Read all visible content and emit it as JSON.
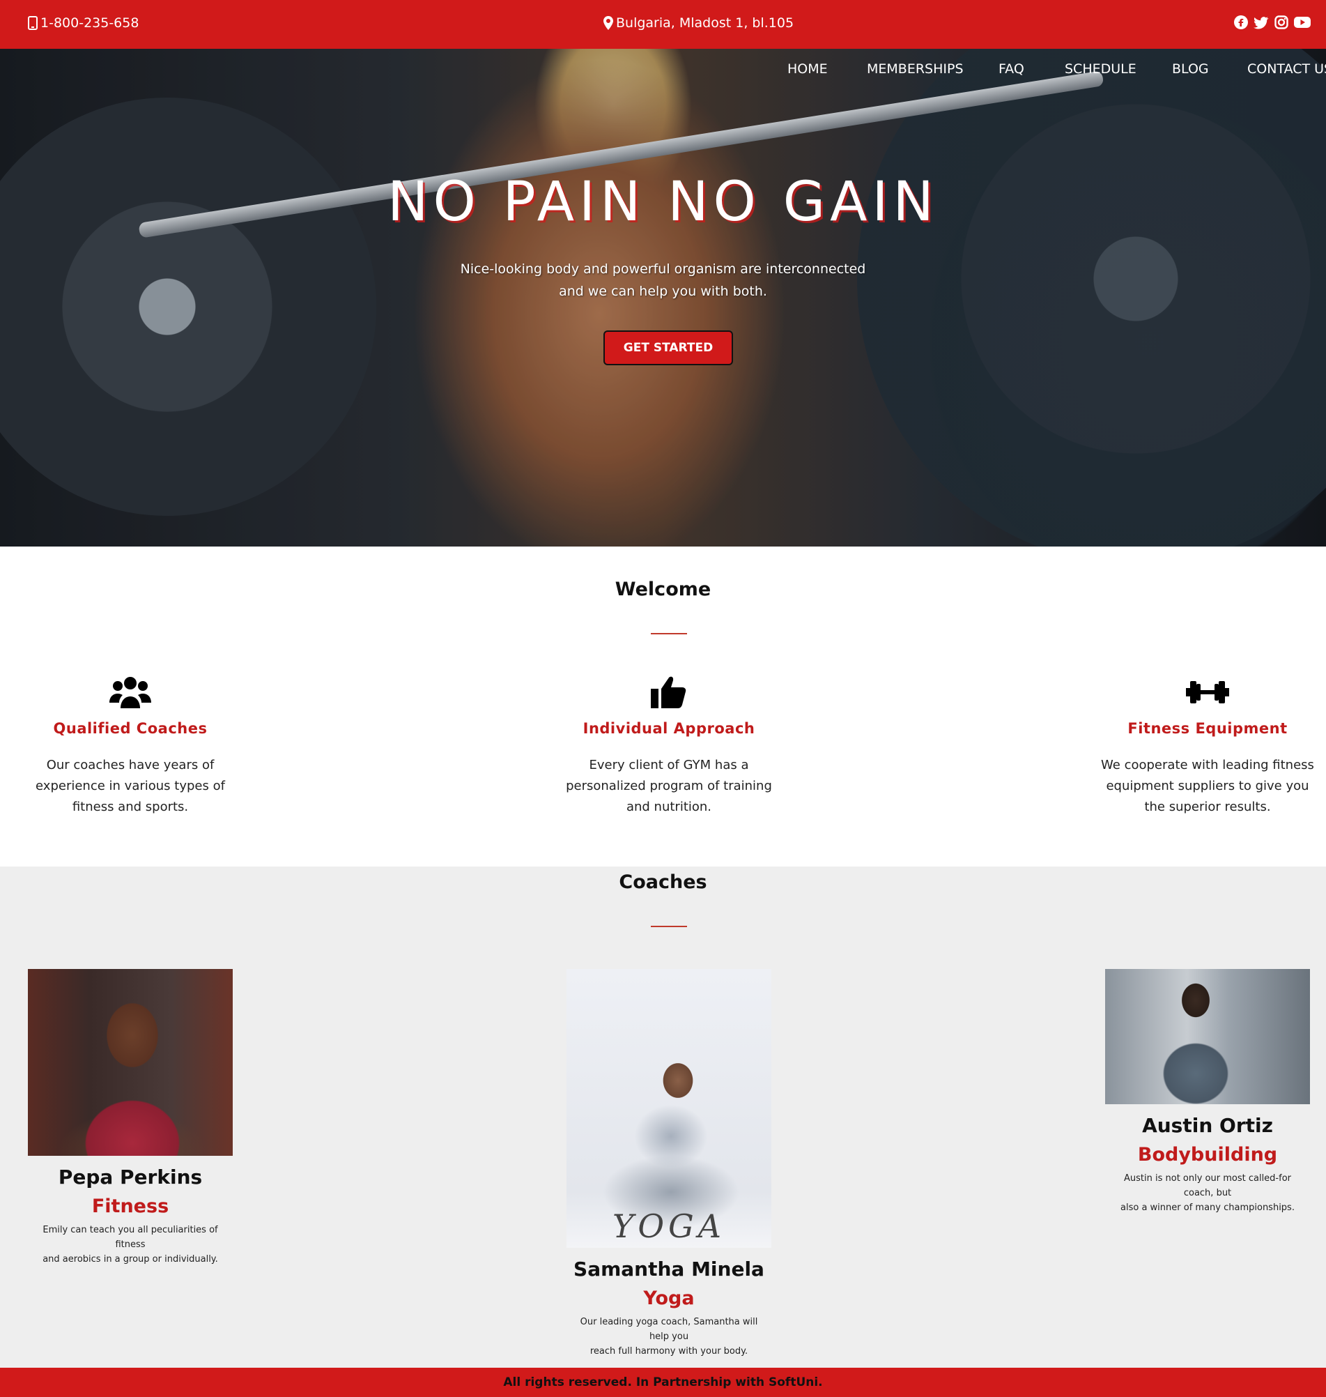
{
  "topbar": {
    "phone": "1-800-235-658",
    "phone_icon": "mobile-phone-icon",
    "address": "Bulgaria, Mladost 1, bl.105",
    "address_icon": "map-marker-icon",
    "social": [
      "facebook-icon",
      "twitter-icon",
      "instagram-icon",
      "youtube-icon"
    ]
  },
  "nav": {
    "items": [
      "HOME",
      "MEMBERSHIPS",
      "FAQ",
      "SCHEDULE",
      "BLOG",
      "CONTACT US"
    ]
  },
  "hero": {
    "title": "NO PAIN NO GAIN",
    "subtitle_line1": "Nice-looking body and powerful organism are interconnected",
    "subtitle_line2": "and we can help you with both.",
    "cta_label": "GET STARTED"
  },
  "welcome": {
    "title": "Welcome",
    "features": [
      {
        "icon": "users-group-icon",
        "title": "Qualified Coaches",
        "lines": [
          "Our coaches have years of",
          "experience in various types of",
          "fitness and sports."
        ]
      },
      {
        "icon": "thumbs-up-icon",
        "title": "Individual Approach",
        "lines": [
          "Every client of GYM has a",
          "personalized program of training",
          "and nutrition."
        ]
      },
      {
        "icon": "dumbbell-icon",
        "title": "Fitness Equipment",
        "lines": [
          "We cooperate with leading fitness",
          "equipment suppliers to give you",
          "the superior results."
        ]
      }
    ]
  },
  "coaches": {
    "title": "Coaches",
    "items": [
      {
        "name": "Pepa Perkins",
        "specialty": "Fitness",
        "lines": [
          "Emily can teach you all peculiarities of fitness",
          "and aerobics in a group or individually."
        ]
      },
      {
        "name": "Samantha Minela",
        "specialty": "Yoga",
        "photo_text": "YOGA",
        "lines": [
          "Our leading yoga coach, Samantha will help you",
          "reach full harmony with your body."
        ]
      },
      {
        "name": "Austin Ortiz",
        "specialty": "Bodybuilding",
        "lines": [
          "Austin is not only our most called-for coach, but",
          "also a winner of many championships."
        ]
      }
    ]
  },
  "footer": {
    "text": "All rights reserved. In Partnership with SoftUni."
  },
  "colors": {
    "brand_red": "#d11a1a",
    "accent_red": "#c01b1b",
    "section_gray": "#eeeeee"
  }
}
